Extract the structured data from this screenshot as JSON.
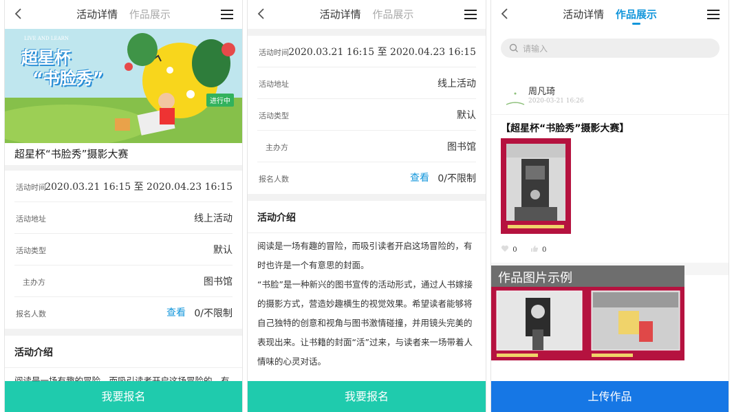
{
  "tabs": {
    "details": "活动详情",
    "showcase": "作品展示"
  },
  "banner": {
    "small_text": "LIVE AND LEARN",
    "line1": "超星杯",
    "line2": "“书脸秀”",
    "status": "进行中"
  },
  "activity": {
    "title": "超星杯“书脸秀”摄影大赛",
    "rows": [
      {
        "label": "活动时间",
        "value": "2020.03.21 16:15 至 2020.04.23 16:15"
      },
      {
        "label": "活动地址",
        "value": "线上活动"
      },
      {
        "label": "活动类型",
        "value": "默认"
      },
      {
        "label": "主办方",
        "value": "图书馆"
      },
      {
        "label": "报名人数",
        "value": "0/不限制",
        "link": "查看"
      }
    ]
  },
  "intro": {
    "heading": "活动介绍",
    "paragraphs": [
      "阅读是一场有趣的冒险，而吸引读者开启这场冒险的，有时也许是一个有意思的封面。",
      "“书脸”是一种新兴的图书宣传的活动形式，通过人书嫁接的摄影方式，营造妙趣横生的视觉效果。希望读者能够将自己独特的创意和视角与图书激情碰撞，并用镜头完美的表现出来。让书籍的封面“活”过来，与读者来一场带着人情味的心灵对话。"
    ],
    "peek": "阅读是一场有趣的冒险，而吸引读者开启这场冒险的，有"
  },
  "buttons": {
    "register": "我要报名",
    "upload": "上传作品"
  },
  "showcase": {
    "search_placeholder": "请输入",
    "user": "周凡琦",
    "time": "2020-03-21 16:26",
    "work_title": "【超星杯“书脸秀”摄影大赛】",
    "likes": "0",
    "thumbs": "0",
    "example_header": "作品图片示例"
  },
  "colors": {
    "accent": "#1296db",
    "green": "#1fcbad",
    "blue": "#1677e5",
    "badge": "#32b25d"
  }
}
